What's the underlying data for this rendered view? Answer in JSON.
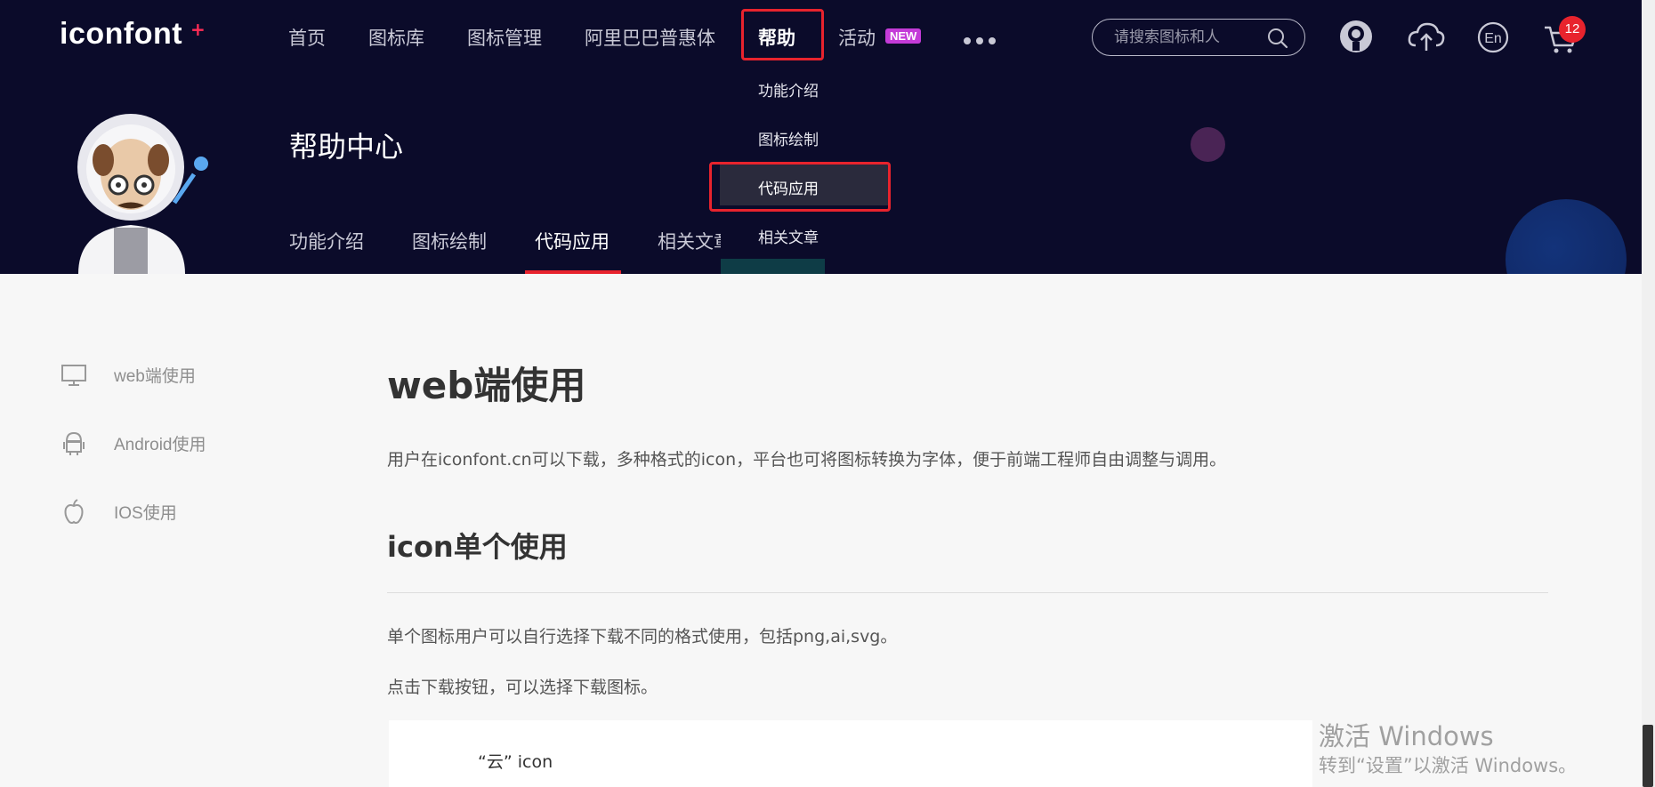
{
  "logo": {
    "text": "iconfont",
    "plus": "+"
  },
  "nav": {
    "items": [
      "首页",
      "图标库",
      "图标管理",
      "阿里巴巴普惠体",
      "帮助",
      "活动"
    ],
    "new_badge": "NEW",
    "active": "帮助"
  },
  "search": {
    "placeholder": "请搜索图标和人"
  },
  "cart": {
    "count": "12"
  },
  "dropdown": {
    "items": [
      "功能介绍",
      "图标绘制",
      "代码应用",
      "相关文章"
    ],
    "selected": "代码应用"
  },
  "hero": {
    "title": "帮助中心",
    "tabs": [
      "功能介绍",
      "图标绘制",
      "代码应用",
      "相关文章"
    ],
    "active_tab": "代码应用"
  },
  "sidebar": {
    "items": [
      {
        "label": "web端使用",
        "icon": "monitor-icon"
      },
      {
        "label": "Android使用",
        "icon": "android-icon"
      },
      {
        "label": "IOS使用",
        "icon": "apple-icon"
      }
    ]
  },
  "content": {
    "title": "web端使用",
    "intro": "用户在iconfont.cn可以下载，多种格式的icon，平台也可将图标转换为字体，便于前端工程师自由调整与调用。",
    "section_title": "icon单个使用",
    "p1": "单个图标用户可以自行选择下载不同的格式使用，包括png,ai,svg。",
    "p2": "点击下载按钮，可以选择下载图标。",
    "card_label": "“云” icon"
  },
  "watermark": {
    "line1": "激活 Windows",
    "line2": "转到“设置”以激活 Windows。"
  },
  "colors": {
    "hero_bg": "#0b0b2a",
    "accent_red": "#e8232d",
    "badge_purple": "#c43bd8"
  }
}
